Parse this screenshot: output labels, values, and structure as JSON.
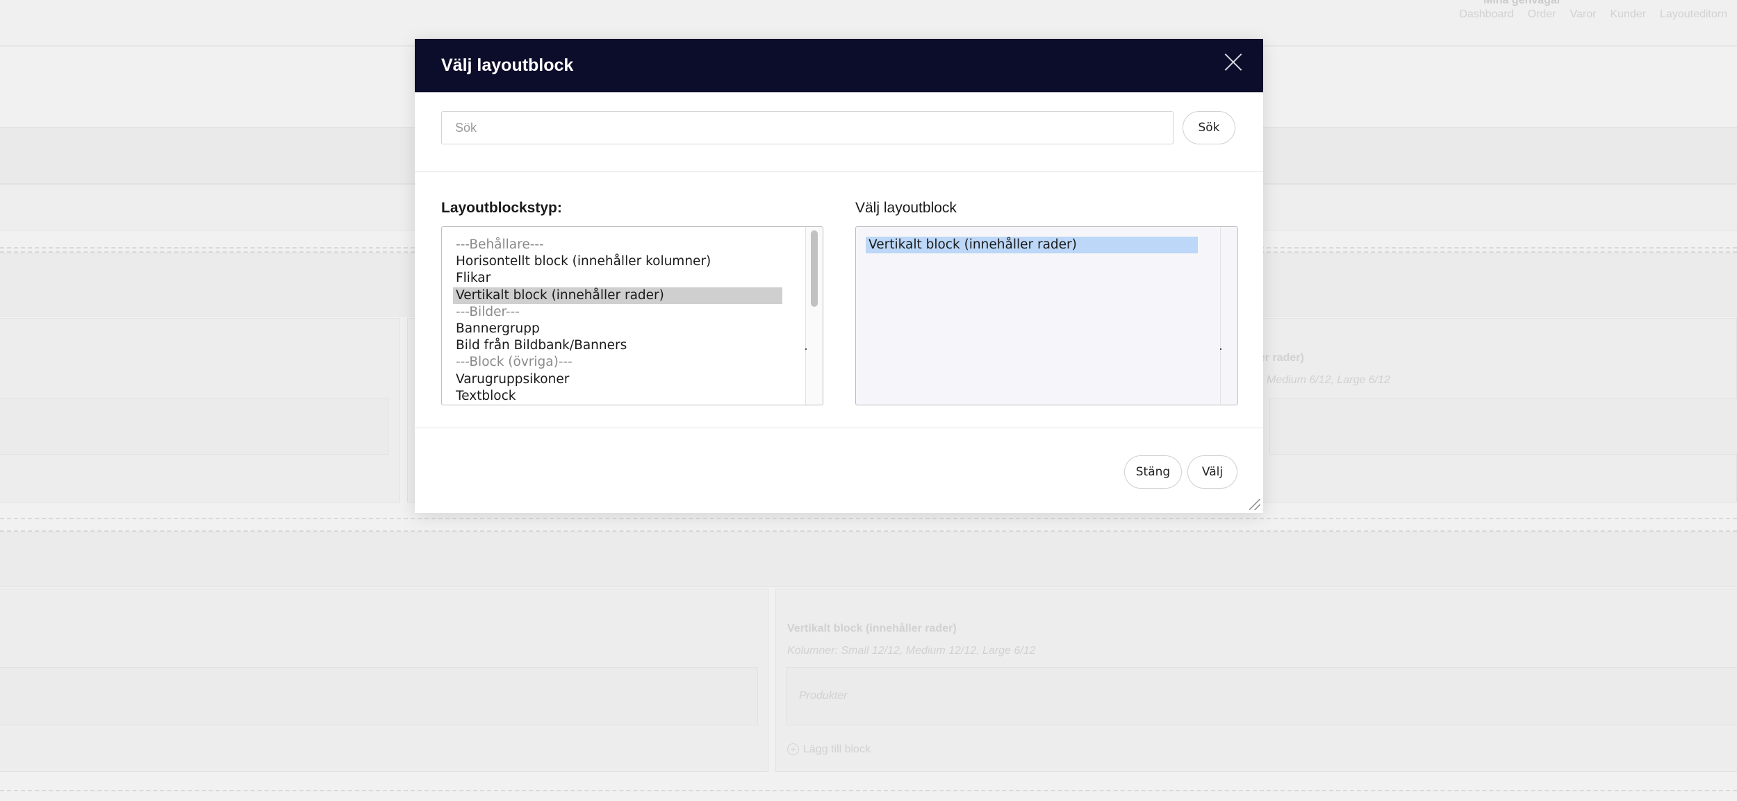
{
  "background": {
    "shortcuts_title": "Mina genvägar",
    "nav": [
      "Dashboard",
      "Order",
      "Varor",
      "Kunder",
      "Layouteditorn"
    ],
    "block_right_title": "ller rader)",
    "block_right_cols": "Medium 6/12, Large 6/12",
    "block_bottom_title": "Vertikalt block (innehåller rader)",
    "block_bottom_cols": "Kolumner: Small 12/12, Medium 12/12, Large 6/12",
    "block_bottom_placeholder": "Produkter",
    "add_block_label": "Lägg till block"
  },
  "modal": {
    "title": "Välj layoutblock",
    "search": {
      "placeholder": "Sök",
      "value": "",
      "button_label": "Sök"
    },
    "left": {
      "label": "Layoutblockstyp:",
      "options": [
        {
          "label": "---Behållare---",
          "group": true
        },
        {
          "label": "Horisontellt block (innehåller kolumner)"
        },
        {
          "label": "Flikar"
        },
        {
          "label": "Vertikalt block (innehåller rader)",
          "selected": true
        },
        {
          "label": "---Bilder---",
          "group": true
        },
        {
          "label": "Bannergrupp"
        },
        {
          "label": "Bild från Bildbank/Banners"
        },
        {
          "label": "---Block (övriga)---",
          "group": true
        },
        {
          "label": "Varugruppsikoner"
        },
        {
          "label": "Textblock"
        }
      ]
    },
    "right": {
      "label": "Välj layoutblock",
      "options": [
        {
          "label": "Vertikalt block (innehåller rader)",
          "selected": true
        }
      ]
    },
    "footer": {
      "close_label": "Stäng",
      "choose_label": "Välj"
    }
  }
}
